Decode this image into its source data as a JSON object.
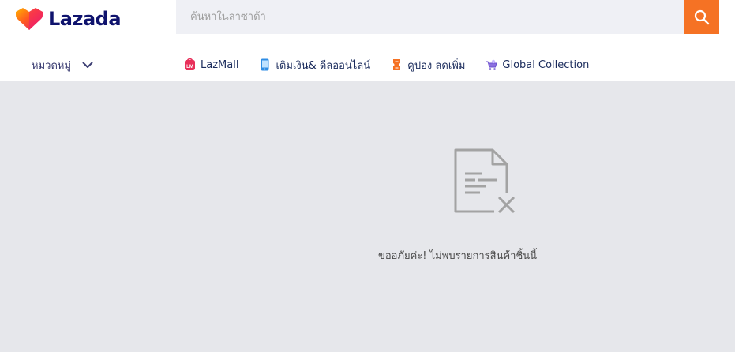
{
  "brand": {
    "name": "Lazada",
    "colors": {
      "primary_text": "#0f136d",
      "accent": "#f57224"
    }
  },
  "search": {
    "placeholder": "ค้นหาในลาซาด้า",
    "button_icon": "search-icon"
  },
  "nav": {
    "category_label": "หมวดหมู่",
    "links": [
      {
        "label": "LazMall",
        "icon": "lazmall-icon"
      },
      {
        "label": "เติมเงิน& ดีลออนไลน์",
        "icon": "mobile-topup-icon"
      },
      {
        "label": "คูปอง ลดเพิ่ม",
        "icon": "coupon-icon"
      },
      {
        "label": "Global Collection",
        "icon": "global-collection-icon"
      }
    ]
  },
  "empty_state": {
    "icon": "no-results-document-icon",
    "message": "ขออภัยค่ะ! ไม่พบรายการสินค้าชิ้นนี้"
  }
}
